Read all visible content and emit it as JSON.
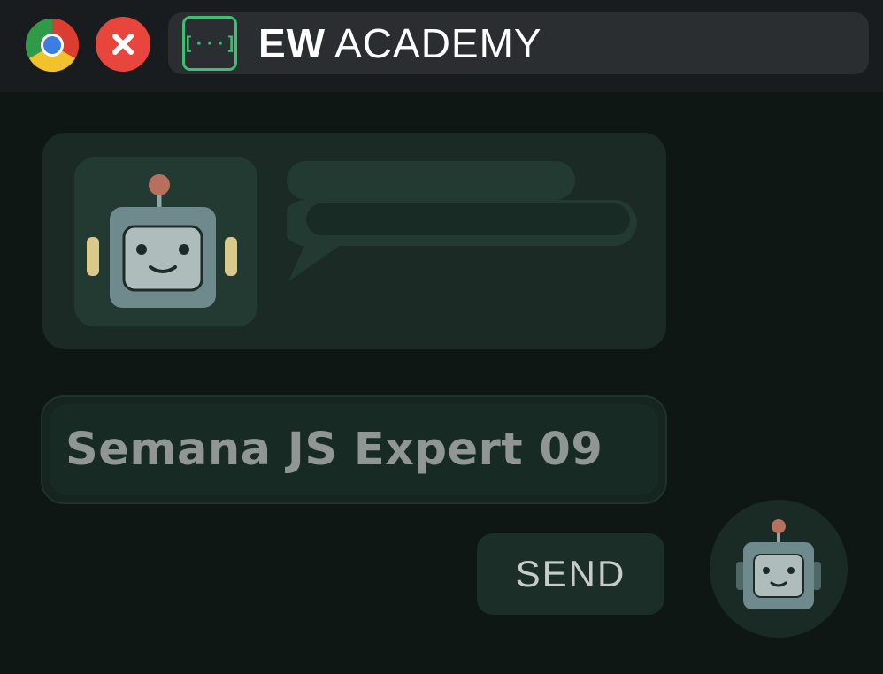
{
  "titlebar": {
    "brand_bold": "EW",
    "brand_regular": "ACADEMY",
    "site_icon_glyph": "[···]",
    "icons": {
      "browser": "chrome-icon",
      "close": "close-icon",
      "site": "code-brackets-icon"
    }
  },
  "chat": {
    "avatar_icon": "robot-icon",
    "bubble_icon": "speech-bubble-icon"
  },
  "prompt": {
    "value": "Semana JS Expert 09"
  },
  "send_button": {
    "label": "SEND"
  },
  "assistant_button": {
    "icon": "robot-icon"
  },
  "colors": {
    "background": "#0f1714",
    "titlebar": "#191c1e",
    "accent_green": "#3fbf72",
    "close_red": "#e8463c",
    "card": "#1b2a25",
    "robot_body": "#6f8a8c",
    "robot_antenna": "#b8705e",
    "robot_ears": "#d9c98a"
  }
}
